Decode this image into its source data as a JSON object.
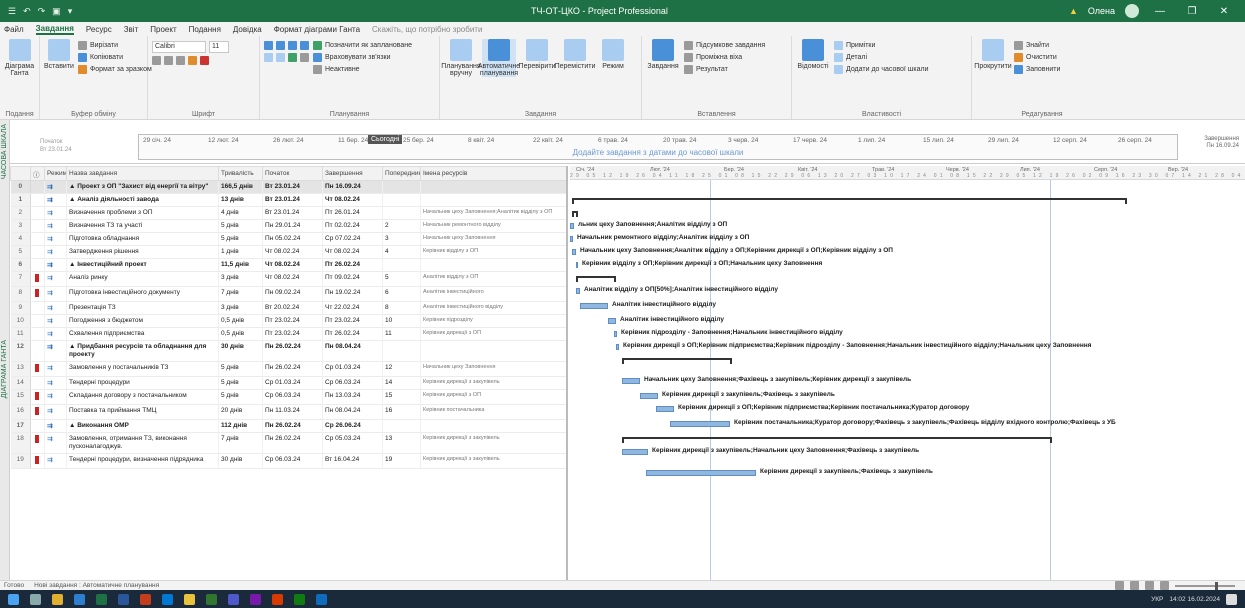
{
  "window": {
    "title": "ТЧ-ОТ-ЦКО - Project Professional",
    "qat": [
      "☰",
      "↶",
      "↷",
      "▣",
      "▾"
    ],
    "warning": "▲",
    "user_name": "Олена",
    "controls": [
      "—",
      "❐",
      "✕"
    ]
  },
  "tabs": [
    "Файл",
    "Завдання",
    "Ресурс",
    "Звіт",
    "Проект",
    "Подання",
    "Довідка",
    "Формат діаграми Ганта"
  ],
  "tell_me": "Скажіть, що потрібно зробити",
  "ribbon": {
    "groups": [
      {
        "name": "Подання",
        "big": [
          "Діаграма Ганта"
        ]
      },
      {
        "name": "Буфер обміну",
        "big": [
          "Вставити"
        ],
        "small": [
          "Вирізати",
          "Копіювати",
          "Формат за зразком"
        ]
      },
      {
        "name": "Шрифт",
        "font": "Calibri",
        "size": "11"
      },
      {
        "name": "Планування",
        "small": [
          "Позначити як заплановане",
          "Враховувати зв'язки",
          "Неактивне"
        ]
      },
      {
        "name": "Завдання",
        "big": [
          "Планування вручну",
          "Автоматичне планування",
          "Перевірити",
          "Перемістити",
          "Режим"
        ]
      },
      {
        "name": "Вставлення",
        "big": [
          "Завдання"
        ],
        "small": [
          "Підсумкове завдання",
          "Проміжна віха",
          "Результат"
        ]
      },
      {
        "name": "Властивості",
        "big": [
          "Відомості"
        ],
        "small": [
          "Примітки",
          "Деталі",
          "Додати до часової шкали"
        ]
      },
      {
        "name": "Редагування",
        "big": [
          "Прокрутити"
        ],
        "small": [
          "Знайти",
          "Очистити",
          "Заповнити"
        ]
      }
    ]
  },
  "side_labels": {
    "timeline": "ЧАСОВА ШКАЛА",
    "gantt": "ДІАГРАМА ГАНТА"
  },
  "timeline": {
    "start_label": "Початок",
    "start_date": "Вт 23.01.24",
    "today_label": "Сьогодні",
    "dates": [
      "29 січ. 24",
      "12 лют. 24",
      "26 лют. 24",
      "11 бер. 24",
      "25 бер. 24",
      "8 квіт. 24",
      "22 квіт. 24",
      "6 трав. 24",
      "20 трав. 24",
      "3 черв. 24",
      "17 черв. 24",
      "1 лип. 24",
      "15 лип. 24",
      "29 лип. 24",
      "12 серп. 24",
      "26 серп. 24"
    ],
    "hint": "Додайте завдання з датами до часової шкали",
    "finish_label": "Завершення",
    "finish_date": "Пн 16.09.24"
  },
  "table": {
    "columns": [
      "",
      "ⓘ",
      "Режим завдання",
      "Назва завдання",
      "Тривалість",
      "Початок",
      "Завершення",
      "Попередники",
      "Імена ресурсів"
    ],
    "rows": [
      {
        "id": "0",
        "name": "▲ Проект з ОП \"Захист від енергії та вітру\"",
        "dur": "166,5 днів",
        "start": "Вт 23.01.24",
        "fin": "Пн 16.09.24",
        "pred": "",
        "res": "",
        "summary": true,
        "ind": false,
        "sel": true
      },
      {
        "id": "1",
        "name": "▲ Аналіз діяльності завода",
        "dur": "13 днів",
        "start": "Вт 23.01.24",
        "fin": "Чт 08.02.24",
        "pred": "",
        "res": "",
        "summary": true,
        "ind": false
      },
      {
        "id": "2",
        "name": "Визначення проблеми з ОП",
        "dur": "4 днів",
        "start": "Вт 23.01.24",
        "fin": "Пт 26.01.24",
        "pred": "",
        "res": "Начальник цеху Заповнення;Аналітик відділу з ОП",
        "summary": false,
        "ind": false
      },
      {
        "id": "3",
        "name": "Визначення ТЗ та участі",
        "dur": "5 днів",
        "start": "Пн 29.01.24",
        "fin": "Пт 02.02.24",
        "pred": "2",
        "res": "Начальник ремонтного відділу",
        "summary": false,
        "ind": false
      },
      {
        "id": "4",
        "name": "Підготовка обладнання",
        "dur": "5 днів",
        "start": "Пн 05.02.24",
        "fin": "Ср 07.02.24",
        "pred": "3",
        "res": "Начальник цеху Заповнення",
        "summary": false,
        "ind": false
      },
      {
        "id": "5",
        "name": "Затвердження рішення",
        "dur": "1 днів",
        "start": "Чт 08.02.24",
        "fin": "Чт 08.02.24",
        "pred": "4",
        "res": "Керівник відділу з ОП",
        "summary": false,
        "ind": false
      },
      {
        "id": "6",
        "name": "▲ Інвестиційний проект",
        "dur": "11,5 днів",
        "start": "Чт 08.02.24",
        "fin": "Пт 26.02.24",
        "pred": "",
        "res": "",
        "summary": true,
        "ind": false
      },
      {
        "id": "7",
        "name": "Аналіз ринку",
        "dur": "3 днів",
        "start": "Чт 08.02.24",
        "fin": "Пт 09.02.24",
        "pred": "5",
        "res": "Аналітик відділу з ОП",
        "summary": false,
        "ind": true
      },
      {
        "id": "8",
        "name": "Підготовка інвестиційного документу",
        "dur": "7 днів",
        "start": "Пн 09.02.24",
        "fin": "Пн 19.02.24",
        "pred": "6",
        "res": "Аналітик інвестиційного",
        "summary": false,
        "ind": true
      },
      {
        "id": "9",
        "name": "Презентація ТЗ",
        "dur": "3 днів",
        "start": "Вт 20.02.24",
        "fin": "Чт 22.02.24",
        "pred": "8",
        "res": "Аналітик інвестиційного відділу",
        "summary": false,
        "ind": false
      },
      {
        "id": "10",
        "name": "Погодження з бюджетом",
        "dur": "0,5 днів",
        "start": "Пт 23.02.24",
        "fin": "Пт 23.02.24",
        "pred": "10",
        "res": "Керівник підрозділу",
        "summary": false,
        "ind": false
      },
      {
        "id": "11",
        "name": "Схвалення підприємства",
        "dur": "0,5 днів",
        "start": "Пт 23.02.24",
        "fin": "Пт 26.02.24",
        "pred": "11",
        "res": "Керівник дирекції з ОП",
        "summary": false,
        "ind": false
      },
      {
        "id": "12",
        "name": "▲ Придбання ресурсів та обладнання для проекту",
        "dur": "30 днів",
        "start": "Пн 26.02.24",
        "fin": "Пн 08.04.24",
        "pred": "",
        "res": "",
        "summary": true,
        "ind": false
      },
      {
        "id": "13",
        "name": "Замовлення у постачальників ТЗ",
        "dur": "5 днів",
        "start": "Пн 26.02.24",
        "fin": "Ср 01.03.24",
        "pred": "12",
        "res": "Начальник цеху Заповнення",
        "summary": false,
        "ind": true
      },
      {
        "id": "14",
        "name": "Тендерні процедури",
        "dur": "5 днів",
        "start": "Ср 01.03.24",
        "fin": "Ср 06.03.24",
        "pred": "14",
        "res": "Керівник дирекції з закупівель",
        "summary": false,
        "ind": false
      },
      {
        "id": "15",
        "name": "Складання договору з постачальником",
        "dur": "5 днів",
        "start": "Ср 06.03.24",
        "fin": "Пн 13.03.24",
        "pred": "15",
        "res": "Керівник дирекції з ОП",
        "summary": false,
        "ind": true
      },
      {
        "id": "16",
        "name": "Поставка та приймання ТМЦ",
        "dur": "20 днів",
        "start": "Пн 11.03.24",
        "fin": "Пн 08.04.24",
        "pred": "16",
        "res": "Керівник постачальника",
        "summary": false,
        "ind": true
      },
      {
        "id": "17",
        "name": "▲ Виконання ОМР",
        "dur": "112 днів",
        "start": "Пн 26.02.24",
        "fin": "Ср 26.06.24",
        "pred": "",
        "res": "",
        "summary": true,
        "ind": false
      },
      {
        "id": "18",
        "name": "Замовлення, отримання ТЗ, виконання пусконалагоджув.",
        "dur": "7 днів",
        "start": "Пн 26.02.24",
        "fin": "Ср 05.03.24",
        "pred": "13",
        "res": "Керівник дирекції з закупівель",
        "summary": false,
        "ind": true
      },
      {
        "id": "19",
        "name": "Тендерні процедури, визначення підрядника",
        "dur": "30 днів",
        "start": "Ср 06.03.24",
        "fin": "Вт 16.04.24",
        "pred": "19",
        "res": "Керівник дирекції з закупівель",
        "summary": false,
        "ind": true
      }
    ]
  },
  "gantt": {
    "months": [
      "Січ. '24",
      "Лют. '24",
      "Бер. '24",
      "Квіт. '24",
      "Трав. '24",
      "Черв. '24",
      "Лип. '24",
      "Серп. '24",
      "Вер. '24"
    ],
    "day_ticks": "29 05 12 19 26 04 11 18 25 01 08 15 22 29 06 13 20 27 03 10 17 24 01 08 15 22 29 05 12 19 26 02 09 16 23 30 07 14 21 28 04 11 18 25 02 09",
    "labels": [
      "льник цеху Заповнення;Аналітик відділу з ОП",
      "Начальник ремонтного відділу;Аналітик відділу з ОП",
      "Начальник цеху Заповнення;Аналітик відділу з ОП;Керівник дирекції з ОП;Керівник відділу з ОП",
      "Керівник відділу з ОП;Керівник дирекції з ОП;Начальник цеху Заповнення",
      "Аналітик відділу з ОП[50%];Аналітик інвестиційного відділу",
      "Аналітик інвестиційного відділу",
      "Аналітик інвестиційного відділу",
      "Керівник підрозділу - Заповнення;Начальник інвестиційного відділу",
      "Керівник дирекції з ОП;Керівник підприємства;Керівник підрозділу - Заповнення;Начальник інвестиційного відділу;Начальник цеху Заповнення",
      "Начальник цеху Заповнення;Фахівець з закупівель;Керівник дирекції з закупівель",
      "Керівник дирекції з закупівель;Фахівець з закупівель",
      "Керівник дирекції з ОП;Керівник підприємства;Керівник постачальника;Куратор договору",
      "Керівник постачальника;Куратор договору;Фахівець з закупівель;Фахівець відділу вхідного контролю;Фахівець з УБ",
      "Керівник дирекції з закупівель;Начальник цеху Заповнення;Фахівець з закупівель",
      "Керівник дирекції з закупівель;Фахівець з закупівель"
    ]
  },
  "status": {
    "ready": "Готово",
    "mode": "Нові завдання : Автоматичне планування"
  },
  "tray": {
    "lang": "УКР",
    "time": "14:02",
    "date": "16.02.2024"
  }
}
